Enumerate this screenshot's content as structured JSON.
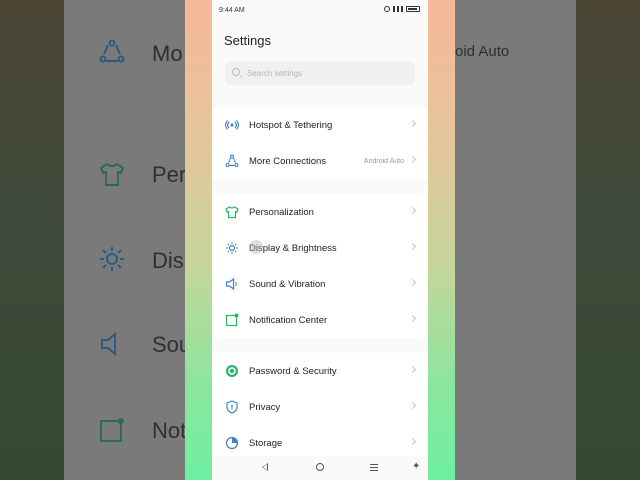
{
  "status_bar": {
    "time": "9:44 AM"
  },
  "header": {
    "title": "Settings"
  },
  "search": {
    "placeholder": "Search settings"
  },
  "groups": [
    {
      "items": [
        {
          "label": "Hotspot & Tethering",
          "icon": "hotspot-icon",
          "value": ""
        },
        {
          "label": "More Connections",
          "icon": "connections-icon",
          "value": "Android Auto"
        }
      ]
    },
    {
      "items": [
        {
          "label": "Personalization",
          "icon": "tshirt-icon",
          "value": ""
        },
        {
          "label": "Display & Brightness",
          "icon": "sun-icon",
          "value": ""
        },
        {
          "label": "Sound & Vibration",
          "icon": "speaker-icon",
          "value": ""
        },
        {
          "label": "Notification Center",
          "icon": "notification-icon",
          "value": ""
        }
      ]
    },
    {
      "items": [
        {
          "label": "Password & Security",
          "icon": "lock-icon",
          "value": ""
        },
        {
          "label": "Privacy",
          "icon": "shield-icon",
          "value": ""
        },
        {
          "label": "Storage",
          "icon": "storage-icon",
          "value": ""
        }
      ]
    }
  ],
  "background": {
    "ghost_texts": [
      "Mo",
      "Per",
      "Dis",
      "Sou",
      "Not"
    ],
    "ghost_right": "oid Auto"
  },
  "colors": {
    "accent_blue": "#3b82c4",
    "accent_green": "#2db36a",
    "frame_top": "#f5b89a",
    "frame_bottom": "#6ef0a2"
  }
}
